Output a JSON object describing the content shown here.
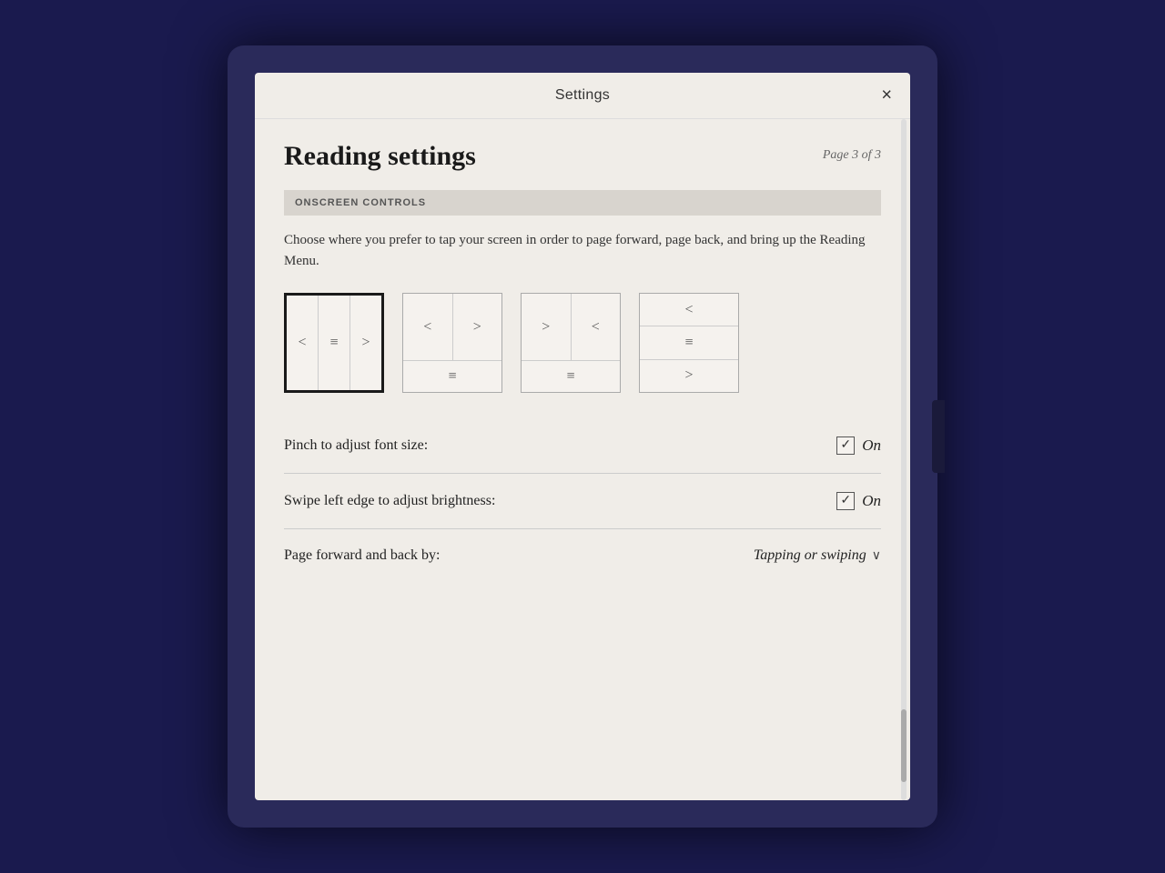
{
  "device": {
    "background": "#1a1a4e"
  },
  "dialog": {
    "header": {
      "title": "Settings",
      "close_label": "×"
    },
    "page_title": "Reading settings",
    "page_indicator": "Page 3 of 3",
    "section_header": "ONSCREEN CONTROLS",
    "description": "Choose where you prefer to tap your screen in order to page forward, page back, and bring up the Reading Menu.",
    "layout_options": [
      {
        "id": "layout1",
        "selected": true,
        "cols_top": [
          "<",
          "≡",
          ">"
        ]
      },
      {
        "id": "layout2",
        "selected": false,
        "cols_top": [
          "<",
          ">"
        ],
        "bottom": "≡"
      },
      {
        "id": "layout3",
        "selected": false,
        "cols_top": [
          ">",
          "<"
        ],
        "bottom": "≡"
      },
      {
        "id": "layout4",
        "selected": false,
        "rows": [
          "<",
          "≡",
          ">"
        ]
      }
    ],
    "settings": [
      {
        "label": "Pinch to adjust font size:",
        "checked": true,
        "value_label": "On"
      },
      {
        "label": "Swipe left edge to adjust brightness:",
        "checked": true,
        "value_label": "On"
      },
      {
        "label": "Page forward and back by:",
        "type": "dropdown",
        "value_label": "Tapping or swiping"
      }
    ]
  }
}
